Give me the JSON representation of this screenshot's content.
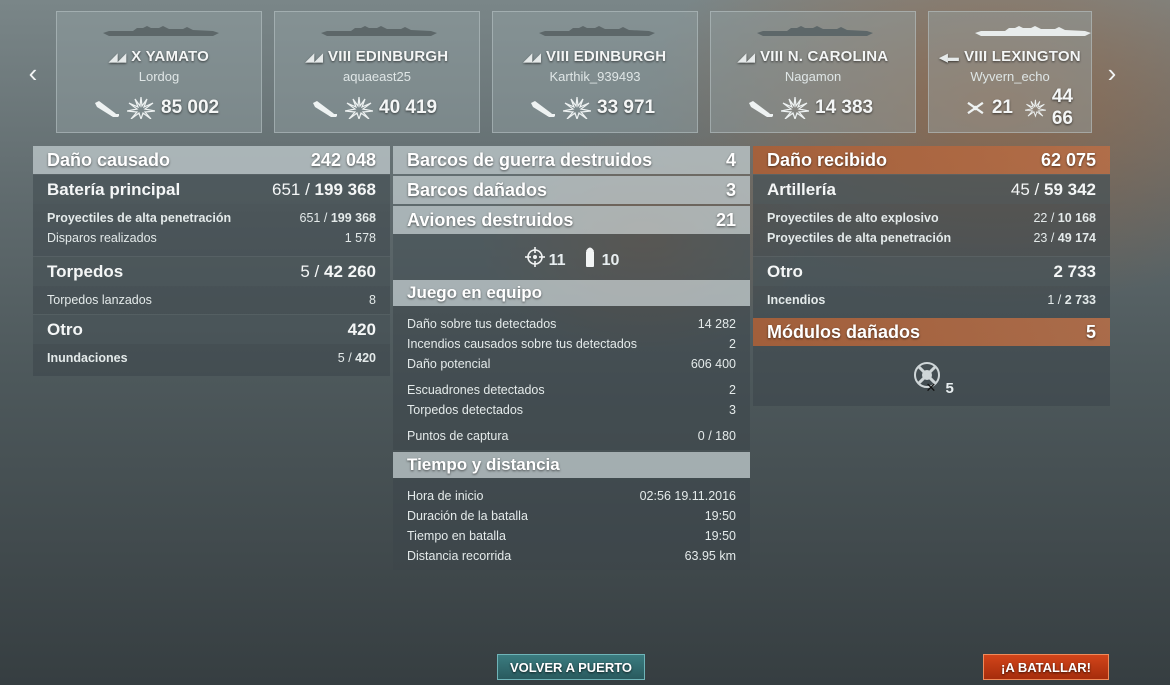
{
  "nav": {
    "prev": "‹",
    "next": "›"
  },
  "ships": [
    {
      "tier_name": "X YAMATO",
      "player": "Lordog",
      "class_icon": "battleship-icon",
      "stat1_icon": "torpedo-hit-icon",
      "stat1_value": "",
      "stat2_icon": "damage-icon",
      "stat2_value": "85 002"
    },
    {
      "tier_name": "VIII EDINBURGH",
      "player": "aquaeast25",
      "class_icon": "cruiser-icon",
      "stat1_icon": "torpedo-hit-icon",
      "stat1_value": "",
      "stat2_icon": "damage-icon",
      "stat2_value": "40 419"
    },
    {
      "tier_name": "VIII EDINBURGH",
      "player": "Karthik_939493",
      "class_icon": "cruiser-icon",
      "stat1_icon": "torpedo-hit-icon",
      "stat1_value": "",
      "stat2_icon": "damage-icon",
      "stat2_value": "33 971"
    },
    {
      "tier_name": "VIII N. CAROLINA",
      "player": "Nagamon",
      "class_icon": "battleship-icon",
      "stat1_icon": "torpedo-hit-icon",
      "stat1_value": "",
      "stat2_icon": "damage-icon",
      "stat2_value": "14 383"
    },
    {
      "tier_name": "VIII LEXINGTON",
      "player": "Wyvern_echo",
      "class_icon": "carrier-icon",
      "stat1_icon": "plane-destroyed-icon",
      "stat1_value": "21",
      "stat2_icon": "damage-icon",
      "stat2_value": "44 66"
    }
  ],
  "left": {
    "header": {
      "label": "Daño causado",
      "value": "242 048"
    },
    "main_battery": {
      "label": "Batería principal",
      "hits": "651",
      "damage": "199 368"
    },
    "main_details": [
      {
        "label": "Proyectiles de alta penetración",
        "hits": "651",
        "damage": "199 368"
      },
      {
        "label": "Disparos realizados",
        "value": "1 578"
      }
    ],
    "torpedoes": {
      "label": "Torpedos",
      "hits": "5",
      "damage": "42 260"
    },
    "torpedo_details": [
      {
        "label": "Torpedos lanzados",
        "value": "8"
      }
    ],
    "other": {
      "label": "Otro",
      "value": "420"
    },
    "other_details": [
      {
        "label": "Inundaciones",
        "hits": "5",
        "damage": "420"
      }
    ]
  },
  "center": {
    "ships_destroyed": {
      "label": "Barcos de guerra destruidos",
      "value": "4"
    },
    "ships_damaged": {
      "label": "Barcos dañados",
      "value": "3"
    },
    "planes_destroyed": {
      "label": "Aviones destruidos",
      "value": "21"
    },
    "aa_kills": "11",
    "fighter_kills": "10",
    "teamwork": {
      "label": "Juego en equipo"
    },
    "teamwork_details": [
      {
        "label": "Daño sobre tus detectados",
        "value": "14 282"
      },
      {
        "label": "Incendios causados sobre tus detectados",
        "value": "2"
      },
      {
        "label": "Daño potencial",
        "value": "606 400"
      },
      {
        "label": "Escuadrones detectados",
        "value": "2"
      },
      {
        "label": "Torpedos detectados",
        "value": "3"
      },
      {
        "label": "Puntos de captura",
        "value": "0 / 180"
      }
    ],
    "time": {
      "label": "Tiempo y distancia"
    },
    "time_details": [
      {
        "label": "Hora de inicio",
        "value": "02:56  19.11.2016"
      },
      {
        "label": "Duración de la batalla",
        "value": "19:50"
      },
      {
        "label": "Tiempo en batalla",
        "value": "19:50"
      },
      {
        "label": "Distancia recorrida",
        "value": "63.95 km"
      }
    ]
  },
  "right": {
    "header": {
      "label": "Daño recibido",
      "value": "62 075"
    },
    "artillery": {
      "label": "Artillería",
      "hits": "45",
      "damage": "59 342"
    },
    "artillery_details": [
      {
        "label": "Proyectiles de alto explosivo",
        "hits": "22",
        "damage": "10 168"
      },
      {
        "label": "Proyectiles de alta penetración",
        "hits": "23",
        "damage": "49 174"
      }
    ],
    "other": {
      "label": "Otro",
      "value": "2 733"
    },
    "other_details": [
      {
        "label": "Incendios",
        "hits": "1",
        "damage": "2 733"
      }
    ],
    "modules": {
      "label": "Módulos dañados",
      "value": "5"
    },
    "module_icon_count": "5"
  },
  "buttons": {
    "port": "VOLVER A PUERTO",
    "battle": "¡A BATALLAR!"
  },
  "colors": {
    "header": "#c3cbcd",
    "orange_header": "#b4683f",
    "port_button": "#2f6a6e",
    "battle_button": "#c03a14"
  }
}
